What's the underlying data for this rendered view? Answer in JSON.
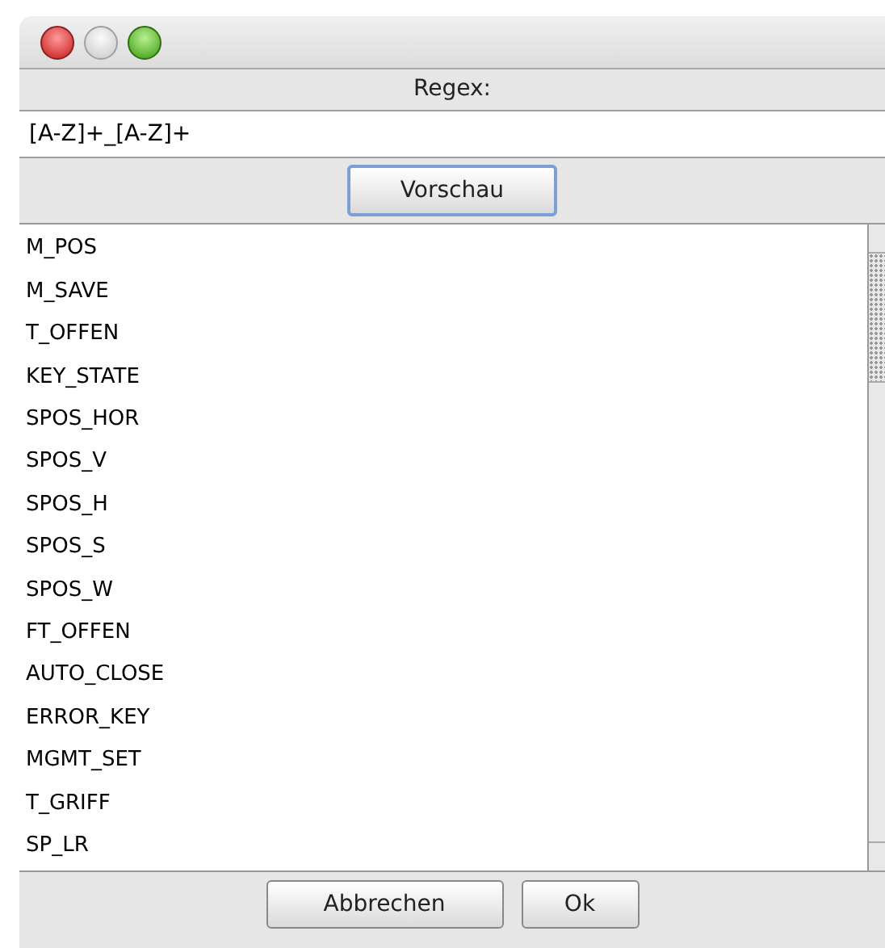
{
  "regex_label": "Regex:",
  "regex_field": {
    "value": "[A-Z]+_[A-Z]+"
  },
  "preview_button": "Vorschau",
  "results": [
    "M_POS",
    "M_SAVE",
    "T_OFFEN",
    "KEY_STATE",
    "SPOS_HOR",
    "SPOS_V",
    "SPOS_H",
    "SPOS_S",
    "SPOS_W",
    "FT_OFFEN",
    "AUTO_CLOSE",
    "ERROR_KEY",
    "MGMT_SET",
    "T_GRIFF",
    "SP_LR"
  ],
  "buttons": [
    "Abbrechen",
    "Ok"
  ]
}
